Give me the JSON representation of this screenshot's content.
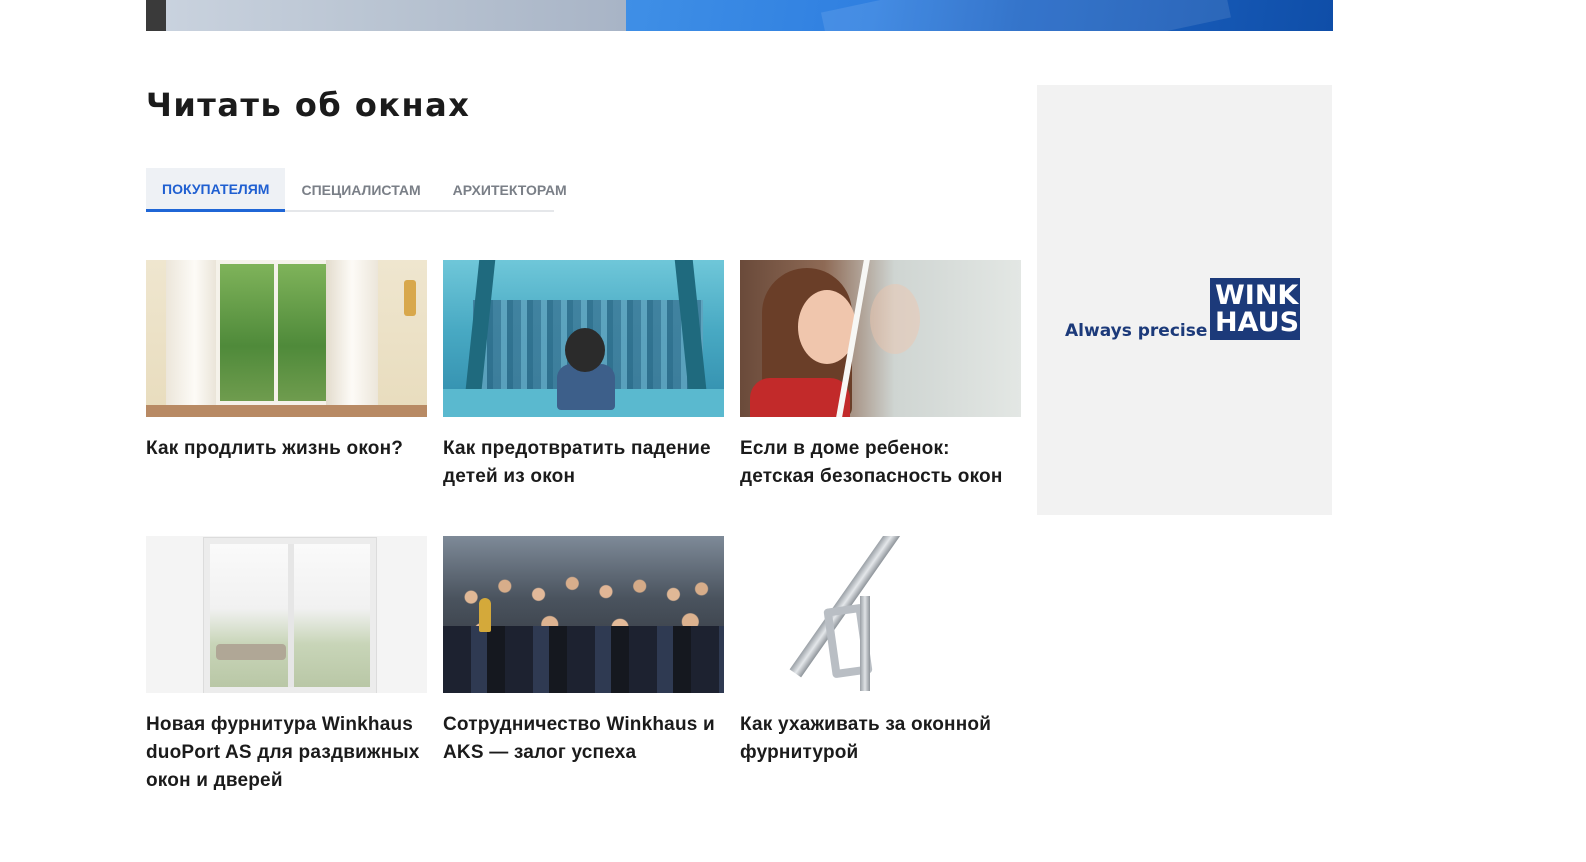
{
  "section": {
    "title": "Читать об окнах"
  },
  "tabs": [
    {
      "label": "Покупателям",
      "active": true
    },
    {
      "label": "Специалистам",
      "active": false
    },
    {
      "label": "Архитекторам",
      "active": false
    }
  ],
  "articles": [
    {
      "title": "Как продлить жизнь окон?",
      "image": "interior-window-photo"
    },
    {
      "title": "Как предотвратить падение детей из окон",
      "image": "child-at-window-photo"
    },
    {
      "title": "Если в доме ребенок: детская безопасность окон",
      "image": "girl-at-window-photo"
    },
    {
      "title": "Новая фурнитура Winkhaus duoPort AS для раздвижных окон и дверей",
      "image": "sliding-door-photo"
    },
    {
      "title": "Сотрудничество Winkhaus и AKS — залог успеха",
      "image": "group-photo"
    },
    {
      "title": "Как ухаживать за оконной фурнитурой",
      "image": "window-hardware-photo"
    }
  ],
  "ad": {
    "tagline": "Always precise",
    "logo_line1": "WINK",
    "logo_line2": "HAUS",
    "brand_color": "#1c3a7a"
  },
  "colors": {
    "accent": "#1f66d6",
    "text": "#1b1b1b",
    "tab_inactive": "#7a7f87"
  }
}
